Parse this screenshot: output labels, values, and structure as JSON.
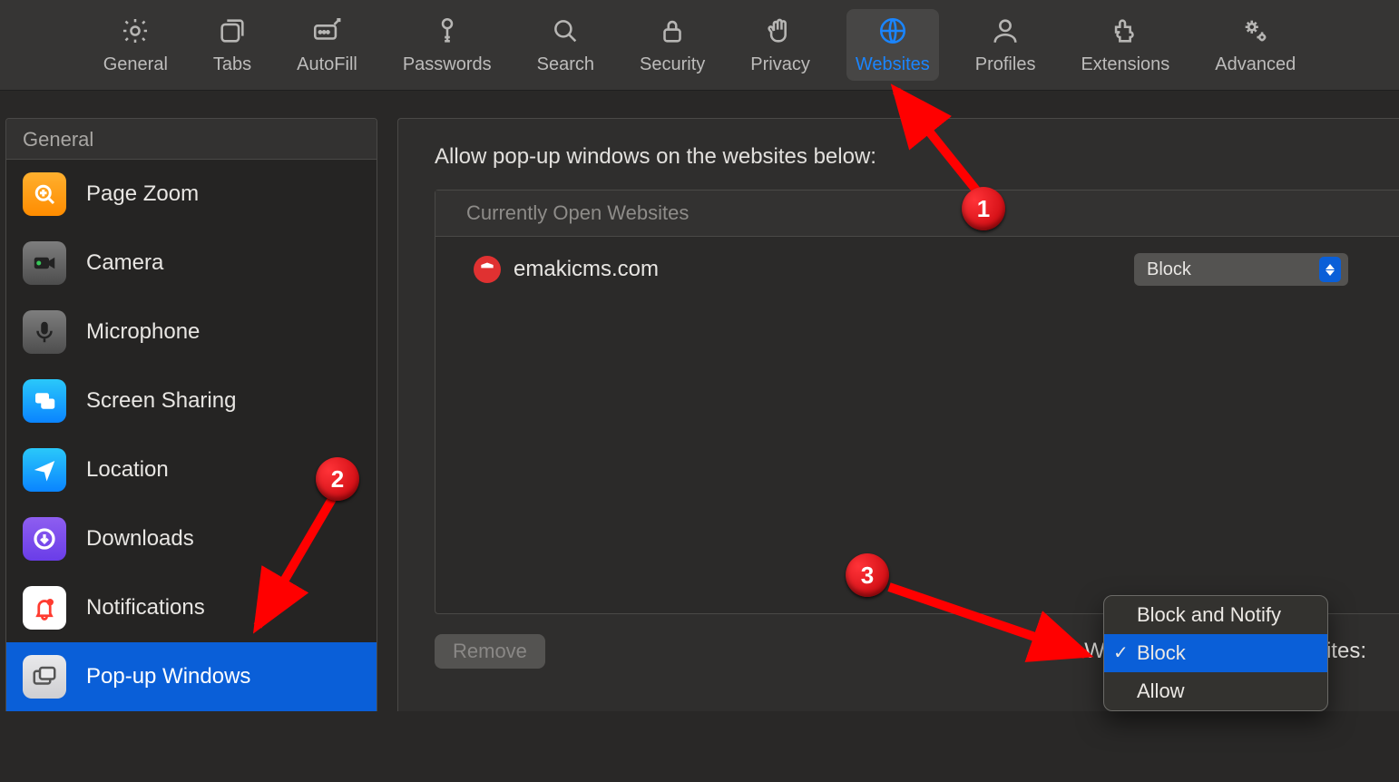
{
  "toolbar": [
    {
      "id": "general",
      "label": "General"
    },
    {
      "id": "tabs",
      "label": "Tabs"
    },
    {
      "id": "autofill",
      "label": "AutoFill"
    },
    {
      "id": "passwords",
      "label": "Passwords"
    },
    {
      "id": "search",
      "label": "Search"
    },
    {
      "id": "security",
      "label": "Security"
    },
    {
      "id": "privacy",
      "label": "Privacy"
    },
    {
      "id": "websites",
      "label": "Websites",
      "active": true
    },
    {
      "id": "profiles",
      "label": "Profiles"
    },
    {
      "id": "extensions",
      "label": "Extensions"
    },
    {
      "id": "advanced",
      "label": "Advanced"
    }
  ],
  "sidebar": {
    "header": "General",
    "items": [
      {
        "id": "page-zoom",
        "label": "Page Zoom"
      },
      {
        "id": "camera",
        "label": "Camera"
      },
      {
        "id": "microphone",
        "label": "Microphone"
      },
      {
        "id": "screen-sharing",
        "label": "Screen Sharing"
      },
      {
        "id": "location",
        "label": "Location"
      },
      {
        "id": "downloads",
        "label": "Downloads"
      },
      {
        "id": "notifications",
        "label": "Notifications"
      },
      {
        "id": "popup-windows",
        "label": "Pop-up Windows",
        "selected": true
      }
    ]
  },
  "main": {
    "title": "Allow pop-up windows on the websites below:",
    "list_header": "Currently Open Websites",
    "sites": [
      {
        "domain": "emakicms.com",
        "setting": "Block"
      }
    ],
    "remove_label": "Remove",
    "footer_label": "When visiting other websites:"
  },
  "popup_menu": {
    "items": [
      {
        "label": "Block and Notify"
      },
      {
        "label": "Block",
        "selected": true
      },
      {
        "label": "Allow"
      }
    ]
  },
  "annotations": {
    "m1": "1",
    "m2": "2",
    "m3": "3"
  }
}
